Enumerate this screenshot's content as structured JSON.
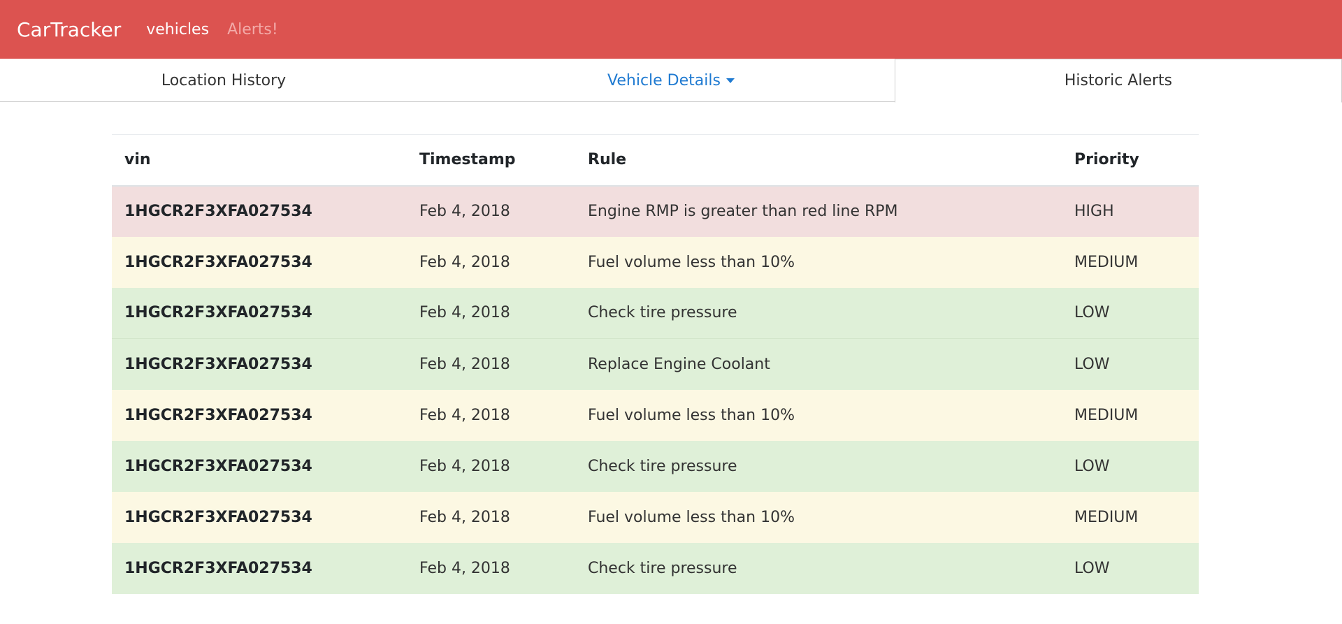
{
  "navbar": {
    "brand": "CarTracker",
    "links": [
      {
        "label": "vehicles",
        "active": true
      },
      {
        "label": "Alerts!",
        "active": false
      }
    ],
    "color": "#dc5350"
  },
  "tabs": {
    "location_history": "Location History",
    "vehicle_details": "Vehicle Details",
    "historic_alerts": "Historic Alerts"
  },
  "table": {
    "headers": {
      "vin": "vin",
      "timestamp": "Timestamp",
      "rule": "Rule",
      "priority": "Priority"
    },
    "rows": [
      {
        "vin": "1HGCR2F3XFA027534",
        "timestamp": "Feb 4, 2018",
        "rule": "Engine RMP is greater than red line RPM",
        "priority": "HIGH"
      },
      {
        "vin": "1HGCR2F3XFA027534",
        "timestamp": "Feb 4, 2018",
        "rule": "Fuel volume less than 10%",
        "priority": "MEDIUM"
      },
      {
        "vin": "1HGCR2F3XFA027534",
        "timestamp": "Feb 4, 2018",
        "rule": "Check tire pressure",
        "priority": "LOW"
      },
      {
        "vin": "1HGCR2F3XFA027534",
        "timestamp": "Feb 4, 2018",
        "rule": "Replace Engine Coolant",
        "priority": "LOW"
      },
      {
        "vin": "1HGCR2F3XFA027534",
        "timestamp": "Feb 4, 2018",
        "rule": "Fuel volume less than 10%",
        "priority": "MEDIUM"
      },
      {
        "vin": "1HGCR2F3XFA027534",
        "timestamp": "Feb 4, 2018",
        "rule": "Check tire pressure",
        "priority": "LOW"
      },
      {
        "vin": "1HGCR2F3XFA027534",
        "timestamp": "Feb 4, 2018",
        "rule": "Fuel volume less than 10%",
        "priority": "MEDIUM"
      },
      {
        "vin": "1HGCR2F3XFA027534",
        "timestamp": "Feb 4, 2018",
        "rule": "Check tire pressure",
        "priority": "LOW"
      }
    ]
  }
}
